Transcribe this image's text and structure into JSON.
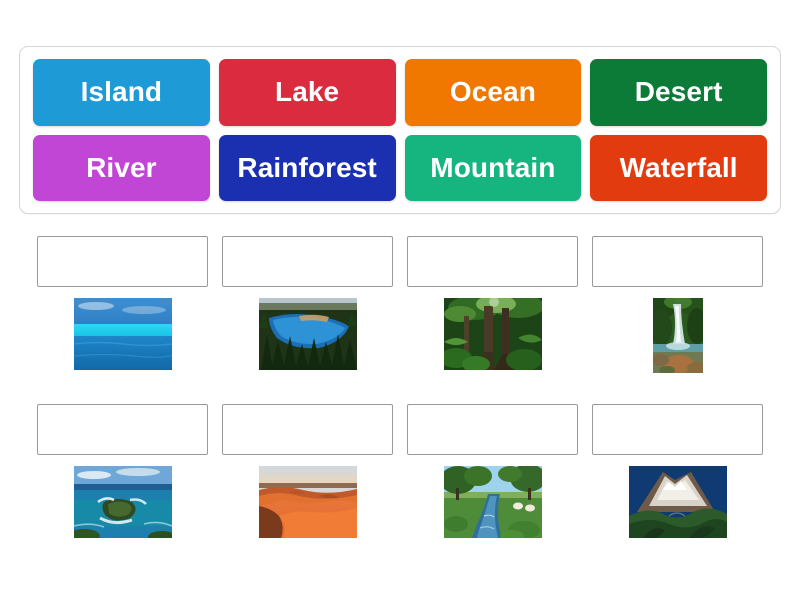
{
  "activity": {
    "type": "drag-and-drop-matching",
    "word_bank": {
      "tiles": [
        {
          "label": "Island",
          "color": "#1E9BD7"
        },
        {
          "label": "Lake",
          "color": "#DB2B3F"
        },
        {
          "label": "Ocean",
          "color": "#F07800"
        },
        {
          "label": "Desert",
          "color": "#0C7B38"
        },
        {
          "label": "River",
          "color": "#C246D6"
        },
        {
          "label": "Rainforest",
          "color": "#1B30B0"
        },
        {
          "label": "Mountain",
          "color": "#16B57F"
        },
        {
          "label": "Waterfall",
          "color": "#E23B10"
        }
      ]
    },
    "answer_rows": [
      {
        "cells": [
          {
            "drop_zone_value": "",
            "image_name": "ocean-photo",
            "orientation": "landscape"
          },
          {
            "drop_zone_value": "",
            "image_name": "lake-photo",
            "orientation": "landscape"
          },
          {
            "drop_zone_value": "",
            "image_name": "rainforest-photo",
            "orientation": "landscape"
          },
          {
            "drop_zone_value": "",
            "image_name": "waterfall-photo",
            "orientation": "portrait"
          }
        ]
      },
      {
        "cells": [
          {
            "drop_zone_value": "",
            "image_name": "island-photo",
            "orientation": "landscape"
          },
          {
            "drop_zone_value": "",
            "image_name": "desert-photo",
            "orientation": "landscape"
          },
          {
            "drop_zone_value": "",
            "image_name": "river-photo",
            "orientation": "landscape"
          },
          {
            "drop_zone_value": "",
            "image_name": "mountain-photo",
            "orientation": "landscape"
          }
        ]
      }
    ]
  }
}
